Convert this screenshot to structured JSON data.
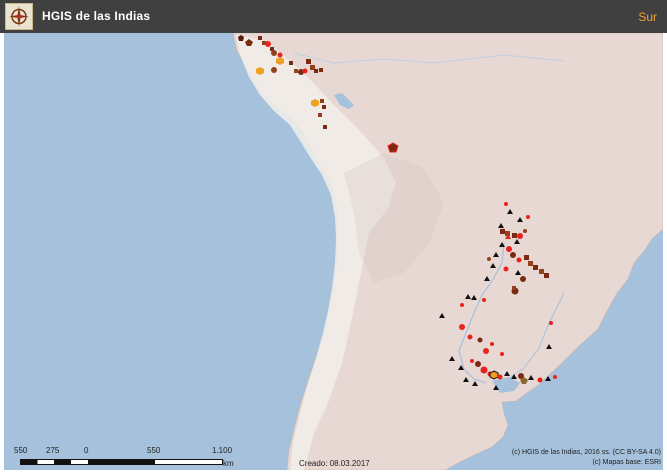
{
  "header": {
    "logo_icon": "compass-rose-emblem-icon",
    "title": "HGIS de las Indias",
    "region": "Sur"
  },
  "colors": {
    "header_bg": "#404040",
    "region_text": "#f0a030",
    "ocean": "#a5c1dc",
    "land": "#e8d8d4",
    "mountains": "#ece8e3",
    "marker_dark": "#7a2a12",
    "marker_brown": "#93401e",
    "marker_red": "#e8221c",
    "marker_orange": "#f0a020",
    "marker_black": "#111111"
  },
  "map": {
    "marker_types": [
      "square-marker",
      "circle-marker",
      "triangle-marker",
      "pentagon-marker",
      "hexagon-marker"
    ]
  },
  "scale_bar": {
    "labels": [
      "550",
      "275",
      "0",
      "550",
      "1.100"
    ],
    "unit": "km"
  },
  "footer": {
    "created": "Creado: 08.03.2017",
    "credits": [
      "(c) HGIS de las Indias, 2016 ss. (CC BY-SA 4.0)",
      "(c) Mapas base: ESRI"
    ]
  }
}
